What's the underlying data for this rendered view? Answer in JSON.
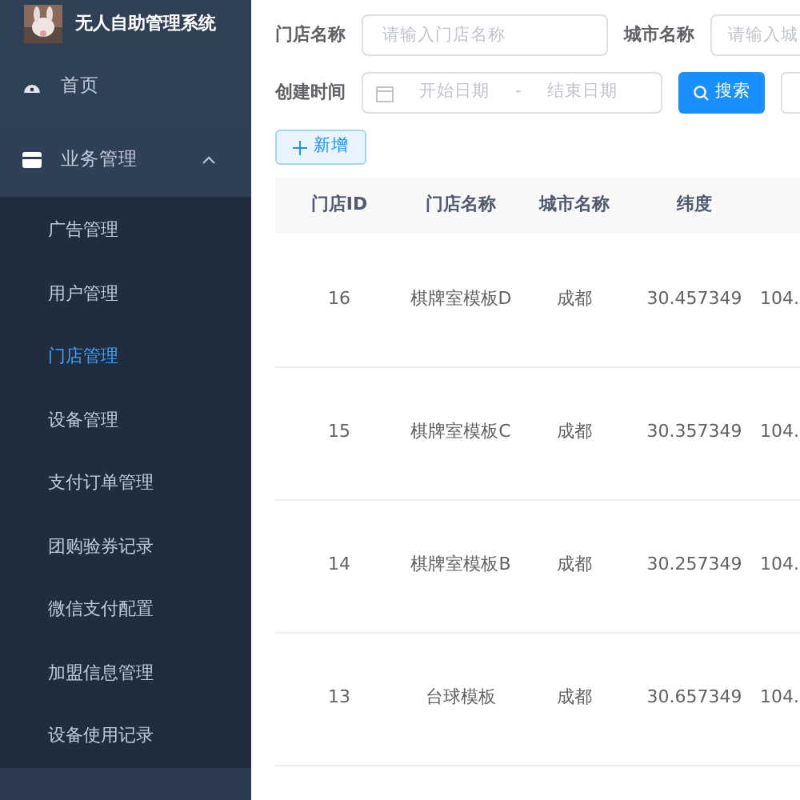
{
  "app": {
    "title": "无人自助管理系统"
  },
  "sidebar": {
    "items": [
      {
        "label": "首页",
        "kind": "home"
      },
      {
        "label": "业务管理",
        "kind": "group",
        "expanded": true,
        "children": [
          {
            "label": "广告管理",
            "selected": false
          },
          {
            "label": "用户管理",
            "selected": false
          },
          {
            "label": "门店管理",
            "selected": true
          },
          {
            "label": "设备管理",
            "selected": false
          },
          {
            "label": "支付订单管理",
            "selected": false
          },
          {
            "label": "团购验券记录",
            "selected": false
          },
          {
            "label": "微信支付配置",
            "selected": false
          },
          {
            "label": "加盟信息管理",
            "selected": false
          },
          {
            "label": "设备使用记录",
            "selected": false
          }
        ]
      }
    ]
  },
  "filters": {
    "store_name": {
      "label": "门店名称",
      "placeholder": "请输入门店名称"
    },
    "city_name": {
      "label": "城市名称",
      "placeholder": "请输入城"
    },
    "created_time": {
      "label": "创建时间",
      "start_placeholder": "开始日期",
      "separator": "-",
      "end_placeholder": "结束日期"
    },
    "search_button": "搜索"
  },
  "add_button": "新增",
  "table": {
    "columns": [
      "门店ID",
      "门店名称",
      "城市名称",
      "纬度"
    ],
    "rows": [
      {
        "id": "16",
        "name": "棋牌室模板D",
        "city": "成都",
        "latitude": "30.457349",
        "column_5": "104."
      },
      {
        "id": "15",
        "name": "棋牌室模板C",
        "city": "成都",
        "latitude": "30.357349",
        "column_5": "104."
      },
      {
        "id": "14",
        "name": "棋牌室模板B",
        "city": "成都",
        "latitude": "30.257349",
        "column_5": "104."
      },
      {
        "id": "13",
        "name": "台球模板",
        "city": "成都",
        "latitude": "30.657349",
        "column_5": "104."
      }
    ]
  }
}
